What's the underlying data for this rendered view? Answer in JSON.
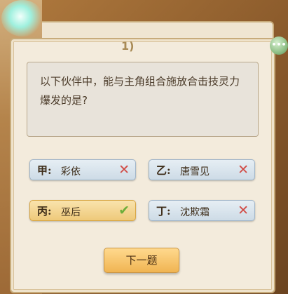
{
  "header": {
    "title_fragment": "1)"
  },
  "chat_icon": {
    "name": "chat-bubble-icon",
    "glyph": "•••"
  },
  "question": {
    "text": "以下伙伴中，能与主角组合施放合击技灵力爆发的是?"
  },
  "options": [
    {
      "key": "甲:",
      "name": "彩依",
      "result": "wrong",
      "result_glyph": "✕"
    },
    {
      "key": "乙:",
      "name": "唐雪见",
      "result": "wrong",
      "result_glyph": "✕"
    },
    {
      "key": "丙:",
      "name": "巫后",
      "result": "correct",
      "result_glyph": "✔"
    },
    {
      "key": "丁:",
      "name": "沈欺霜",
      "result": "wrong",
      "result_glyph": "✕"
    }
  ],
  "next_button": {
    "label": "下一题"
  },
  "colors": {
    "correct": "#6dae3a",
    "wrong": "#d14a44",
    "button": "#f0b452"
  }
}
